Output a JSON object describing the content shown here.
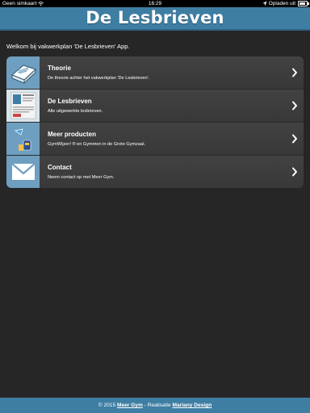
{
  "status_bar": {
    "carrier": "Geen simkaart",
    "time": "16:29",
    "charging_text": "Opladen uit"
  },
  "header": {
    "title": "De Lesbrieven"
  },
  "welcome_text": "Welkom bij vakwerkplan 'De Lesbrieven' App.",
  "menu": [
    {
      "title": "Theorie",
      "subtitle": "De theorie achter het vakwerkplan 'De Lesbrieven'.",
      "icon": "book-icon"
    },
    {
      "title": "De Lesbrieven",
      "subtitle": "Alle uitgewerkte lesbrieven.",
      "icon": "document-icon"
    },
    {
      "title": "Meer producten",
      "subtitle": "GymWijzer! ® en Gymmen in de Grote Gymzaal.",
      "icon": "products-icon"
    },
    {
      "title": "Contact",
      "subtitle": "Neem contact op met Meer Gym.",
      "icon": "envelope-icon"
    }
  ],
  "footer": {
    "prefix": "© 2015 ",
    "link1": "Meer Gym",
    "middle": " - Realisatie ",
    "link2": "Mariany Design"
  },
  "colors": {
    "header": "#3f7ea3",
    "background": "#262626",
    "list_item": "#3a3a3a",
    "thumb": "#6e9fc0"
  }
}
